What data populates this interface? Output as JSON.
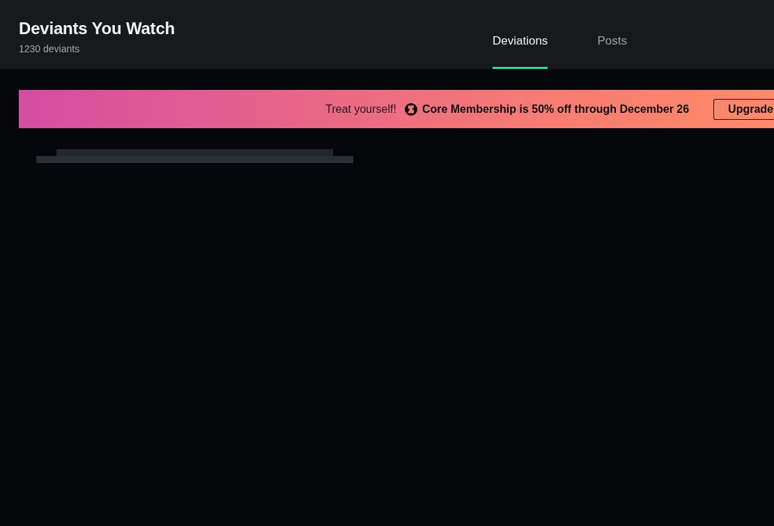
{
  "header": {
    "title": "Deviants You Watch",
    "subtitle": "1230 deviants"
  },
  "tabs": [
    {
      "label": "Deviations",
      "selected": true
    },
    {
      "label": "Posts",
      "selected": false
    }
  ],
  "promo_banner": {
    "lead": "Treat yourself!",
    "message": "Core Membership is 50% off through December 26",
    "button": "Upgrade"
  }
}
